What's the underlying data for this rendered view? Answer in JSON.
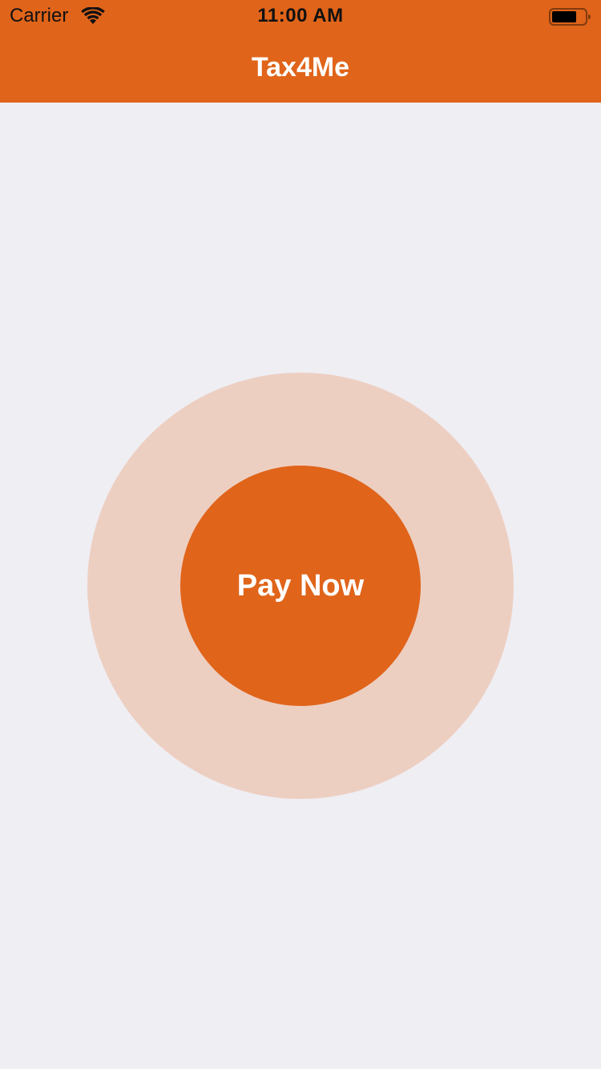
{
  "status_bar": {
    "carrier": "Carrier",
    "time": "11:00 AM",
    "wifi_icon": "wifi-icon",
    "battery_icon": "battery-icon"
  },
  "nav": {
    "title": "Tax4Me"
  },
  "main": {
    "pay_button_label": "Pay Now"
  },
  "colors": {
    "brand": "#E0641A",
    "halo": "#EDCFC2",
    "background": "#EFEEF3",
    "text_on_brand": "#FFFFFF"
  }
}
